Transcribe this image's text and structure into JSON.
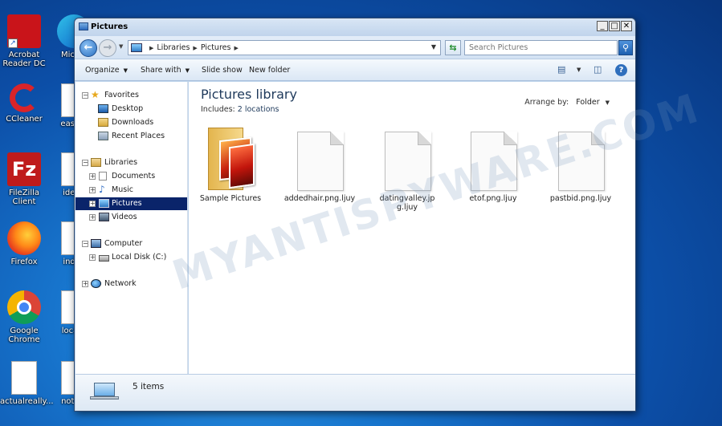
{
  "desktop": {
    "icons": [
      {
        "label": "Acrobat Reader DC",
        "icon": "acrobat-icon"
      },
      {
        "label": "CCleaner",
        "icon": "ccleaner-icon"
      },
      {
        "label": "FileZilla Client",
        "icon": "filezilla-icon",
        "glyph": "Fz"
      },
      {
        "label": "Firefox",
        "icon": "firefox-icon"
      },
      {
        "label": "Google Chrome",
        "icon": "chrome-icon"
      },
      {
        "label": "actualreally...",
        "icon": "document-icon"
      },
      {
        "label": "Micros",
        "icon": "edge-icon"
      },
      {
        "label": "easym",
        "icon": "document-icon"
      },
      {
        "label": "ideap",
        "icon": "document-icon"
      },
      {
        "label": "index",
        "icon": "document-icon"
      },
      {
        "label": "locate",
        "icon": "document-icon"
      },
      {
        "label": "nothin",
        "icon": "document-icon"
      }
    ]
  },
  "window": {
    "title": "Pictures",
    "buttons": {
      "minimize": "_",
      "maximize": "□",
      "close": "✕"
    },
    "address": {
      "crumbs": [
        "Libraries",
        "Pictures"
      ]
    },
    "search": {
      "placeholder": "Search Pictures"
    },
    "toolbar": {
      "organize": "Organize",
      "share_with": "Share with",
      "slide_show": "Slide show",
      "new_folder": "New folder",
      "help": "?"
    },
    "nav": {
      "favorites": "Favorites",
      "desktop": "Desktop",
      "downloads": "Downloads",
      "recent_places": "Recent Places",
      "libraries": "Libraries",
      "documents": "Documents",
      "music": "Music",
      "pictures": "Pictures",
      "videos": "Videos",
      "computer": "Computer",
      "local_disk": "Local Disk (C:)",
      "network": "Network"
    },
    "content": {
      "title": "Pictures library",
      "includes_label": "Includes:",
      "includes_value": "2 locations",
      "arrange_label": "Arrange by:",
      "arrange_value": "Folder"
    },
    "files": [
      {
        "name": "Sample Pictures",
        "type": "folder"
      },
      {
        "name": "addedhair.png.ljuy",
        "type": "file"
      },
      {
        "name": "datingvalley.jpg.ljuy",
        "type": "file"
      },
      {
        "name": "etof.png.ljuy",
        "type": "file"
      },
      {
        "name": "pastbid.png.ljuy",
        "type": "file"
      }
    ],
    "status": {
      "count": "5 items"
    }
  },
  "watermark": "MYANTISPYWARE.COM",
  "colors": {
    "selection": "#0a246a",
    "desktop": "#1877cf",
    "title_text": "#1e395b"
  }
}
